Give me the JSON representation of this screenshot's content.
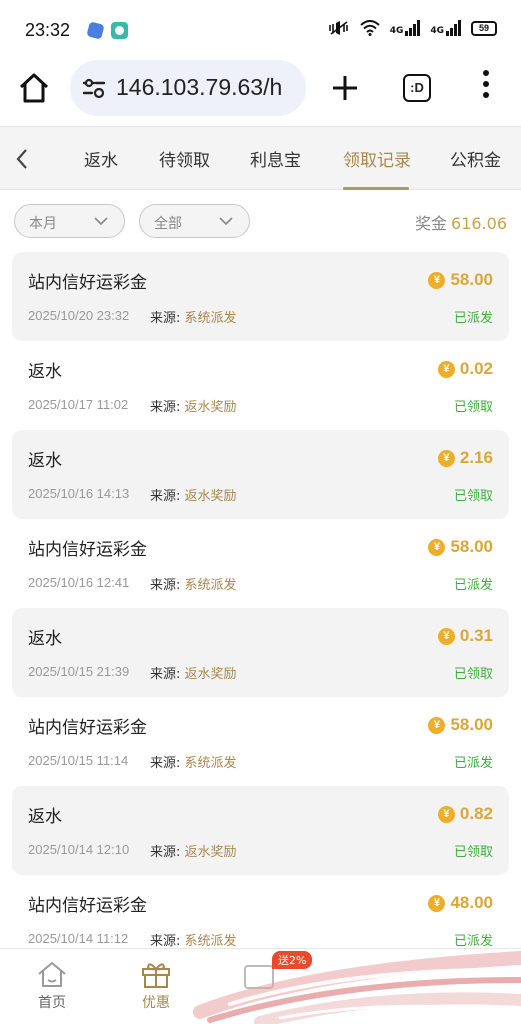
{
  "status_bar": {
    "time": "23:32",
    "network_1": "4G",
    "network_2": "4G",
    "battery": "59"
  },
  "browser": {
    "url": "146.103.79.63/h",
    "tabs_label": ":D"
  },
  "nav": {
    "tabs": [
      {
        "label": "返水"
      },
      {
        "label": "待领取"
      },
      {
        "label": "利息宝"
      },
      {
        "label": "领取记录"
      },
      {
        "label": "公积金"
      }
    ],
    "active_index": 3
  },
  "filters": {
    "period": "本月",
    "type": "全部"
  },
  "bonus": {
    "label": "奖金",
    "value": "616.06"
  },
  "records": [
    {
      "title": "站内信好运彩金",
      "amount": "58.00",
      "date": "2025/10/20 23:32",
      "source_label": "来源:",
      "source": "系统派发",
      "status": "已派发"
    },
    {
      "title": "返水",
      "amount": "0.02",
      "date": "2025/10/17 11:02",
      "source_label": "来源:",
      "source": "返水奖励",
      "status": "已领取"
    },
    {
      "title": "返水",
      "amount": "2.16",
      "date": "2025/10/16 14:13",
      "source_label": "来源:",
      "source": "返水奖励",
      "status": "已领取"
    },
    {
      "title": "站内信好运彩金",
      "amount": "58.00",
      "date": "2025/10/16 12:41",
      "source_label": "来源:",
      "source": "系统派发",
      "status": "已派发"
    },
    {
      "title": "返水",
      "amount": "0.31",
      "date": "2025/10/15 21:39",
      "source_label": "来源:",
      "source": "返水奖励",
      "status": "已领取"
    },
    {
      "title": "站内信好运彩金",
      "amount": "58.00",
      "date": "2025/10/15 11:14",
      "source_label": "来源:",
      "source": "系统派发",
      "status": "已派发"
    },
    {
      "title": "返水",
      "amount": "0.82",
      "date": "2025/10/14 12:10",
      "source_label": "来源:",
      "source": "返水奖励",
      "status": "已领取"
    },
    {
      "title": "站内信好运彩金",
      "amount": "48.00",
      "date": "2025/10/14 11:12",
      "source_label": "来源:",
      "source": "系统派发",
      "status": "已派发"
    }
  ],
  "coin_symbol": "¥",
  "bottom_nav": {
    "home": "首页",
    "offers": "优惠",
    "promo_badge": "送2%"
  },
  "colors": {
    "accent_gold": "#a8874f",
    "amount_gold": "#d9a73a",
    "status_green": "#3fae3f",
    "coin": "#efae2a",
    "promo_red": "#e84a2f"
  }
}
